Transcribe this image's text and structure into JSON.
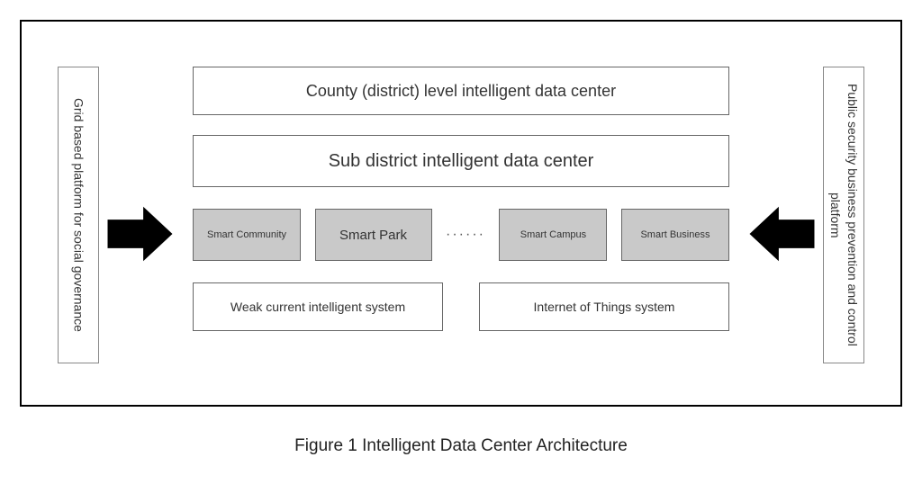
{
  "left_panel": "Grid based platform for social governance",
  "right_panel": "Public security business prevention and control platform",
  "tier1": "County (district) level intelligent data center",
  "tier2": "Sub district intelligent data center",
  "smart": {
    "a": "Smart Community",
    "b": "Smart Park",
    "dots": "······",
    "c": "Smart Campus",
    "d": "Smart Business"
  },
  "bottom": {
    "left": "Weak current intelligent system",
    "right": "Internet of Things system"
  },
  "caption": "Figure 1 Intelligent Data Center Architecture"
}
